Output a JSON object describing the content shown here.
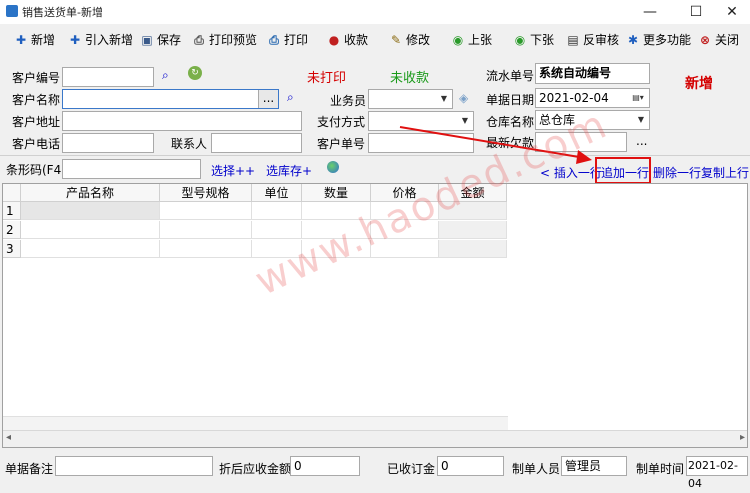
{
  "window": {
    "title": "销售送货单-新增",
    "minimize": "—",
    "maximize": "☐",
    "close": "✕"
  },
  "toolbar": [
    {
      "label": "新增",
      "icon": "plus-icon",
      "glyph": "✚",
      "color": "#1f5fbf"
    },
    {
      "label": "引入新增",
      "icon": "plus-icon",
      "glyph": "✚",
      "color": "#1f5fbf"
    },
    {
      "label": "保存",
      "icon": "save-icon",
      "glyph": "▣",
      "color": "#3a5a8a"
    },
    {
      "label": "打印预览",
      "icon": "print-preview-icon",
      "glyph": "⎙",
      "color": "#555"
    },
    {
      "label": "打印",
      "icon": "print-icon",
      "glyph": "⎙",
      "color": "#2a6ab0"
    },
    {
      "label": "收款",
      "icon": "payment-icon",
      "glyph": "●",
      "color": "#c02020"
    },
    {
      "label": "修改",
      "icon": "edit-icon",
      "glyph": "✎",
      "color": "#8a6a10"
    },
    {
      "label": "上张",
      "icon": "previous-icon",
      "glyph": "◉",
      "color": "#2a9a2a"
    },
    {
      "label": "下张",
      "icon": "next-icon",
      "glyph": "◉",
      "color": "#2a9a2a"
    },
    {
      "label": "反审核",
      "icon": "unaudit-icon",
      "glyph": "▤",
      "color": "#333"
    },
    {
      "label": "更多功能",
      "icon": "more-functions-icon",
      "glyph": "✱",
      "color": "#1f5fbf"
    },
    {
      "label": "关闭",
      "icon": "close-icon",
      "glyph": "⊗",
      "color": "#c02020"
    }
  ],
  "form": {
    "customer_code_label": "客户编号",
    "customer_name_label": "客户名称",
    "customer_address_label": "客户地址",
    "customer_phone_label": "客户电话",
    "contact_label": "联系人",
    "unprinted_status": "未打印",
    "unpaid_status": "未收款",
    "salesperson_label": "业务员",
    "payment_method_label": "支付方式",
    "customer_order_label": "客户单号",
    "serial_label": "流水单号",
    "serial_value": "系统自动编号",
    "date_label": "单据日期",
    "date_value": "2021-02-04",
    "warehouse_label": "仓库名称",
    "warehouse_value": "总仓库",
    "latest_debt_label": "最新欠款",
    "mode_label": "新增",
    "browse_button": "...",
    "debt_more": "..."
  },
  "barcode": {
    "label": "条形码(F4)",
    "select_link": "选择++",
    "select_stock_link": "选库存+",
    "insert_row": "< 插入一行",
    "append_row": "追加一行",
    "delete_row": "删除一行",
    "copy_row": "复制上行"
  },
  "grid": {
    "columns": [
      "产品名称",
      "型号规格",
      "单位",
      "数量",
      "价格",
      "金额"
    ],
    "rows": [
      "1",
      "2",
      "3"
    ]
  },
  "footer": {
    "remark_label": "单据备注",
    "discount_label": "折后应收金额",
    "discount_value": "0",
    "received_label": "已收订金",
    "received_value": "0",
    "maker_label": "制单人员",
    "maker_value": "管理员",
    "time_label": "制单时间",
    "time_value": "2021-02-04"
  },
  "watermark": "www.haoded.com",
  "colors": {
    "highlight": "#e01010",
    "link": "#0000cc"
  }
}
